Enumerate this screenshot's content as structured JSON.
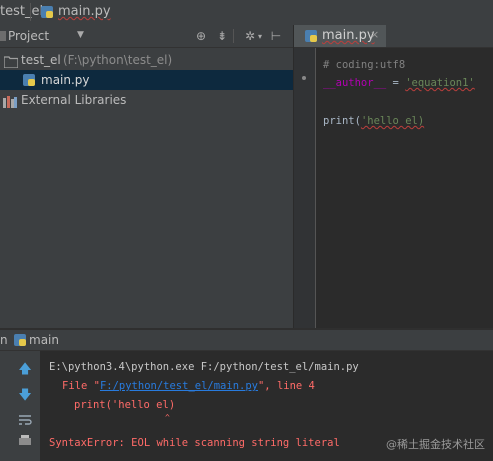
{
  "breadcrumb": {
    "project": "test_el",
    "file": "main.py"
  },
  "project_panel": {
    "title": "Project",
    "dropdown_icon": "triangle-down",
    "tool_icons": [
      "crosshair-icon",
      "collapse-icon",
      "gear-icon",
      "hide-icon"
    ],
    "tree": {
      "root": {
        "name": "test_el",
        "path": "(F:\\python\\test_el)"
      },
      "file": {
        "name": "main.py"
      },
      "external": {
        "name": "External Libraries"
      }
    }
  },
  "editor": {
    "tab": {
      "label": "main.py",
      "close": "×"
    },
    "lines": {
      "l1": "# coding:utf8",
      "l2a": "__author__",
      "l2b": " = ",
      "l2c": "'equation1'",
      "l4a": "print(",
      "l4b": "'hello el)"
    }
  },
  "run_panel": {
    "label": "main",
    "prefix": "n",
    "toolbar": [
      "up-arrow-icon",
      "down-arrow-icon",
      "soft-wrap-icon",
      "print-icon",
      "trash-icon"
    ],
    "console": {
      "cmd": "E:\\python3.4\\python.exe F:/python/test_el/main.py",
      "file_prefix": "File \"",
      "file_link": "F:/python/test_el/main.py",
      "file_suffix": "\", line 4",
      "src_line": "print('hello el)",
      "caret": "^",
      "error": "SyntaxError: EOL while scanning string literal"
    }
  },
  "watermark": "@稀土掘金技术社区"
}
